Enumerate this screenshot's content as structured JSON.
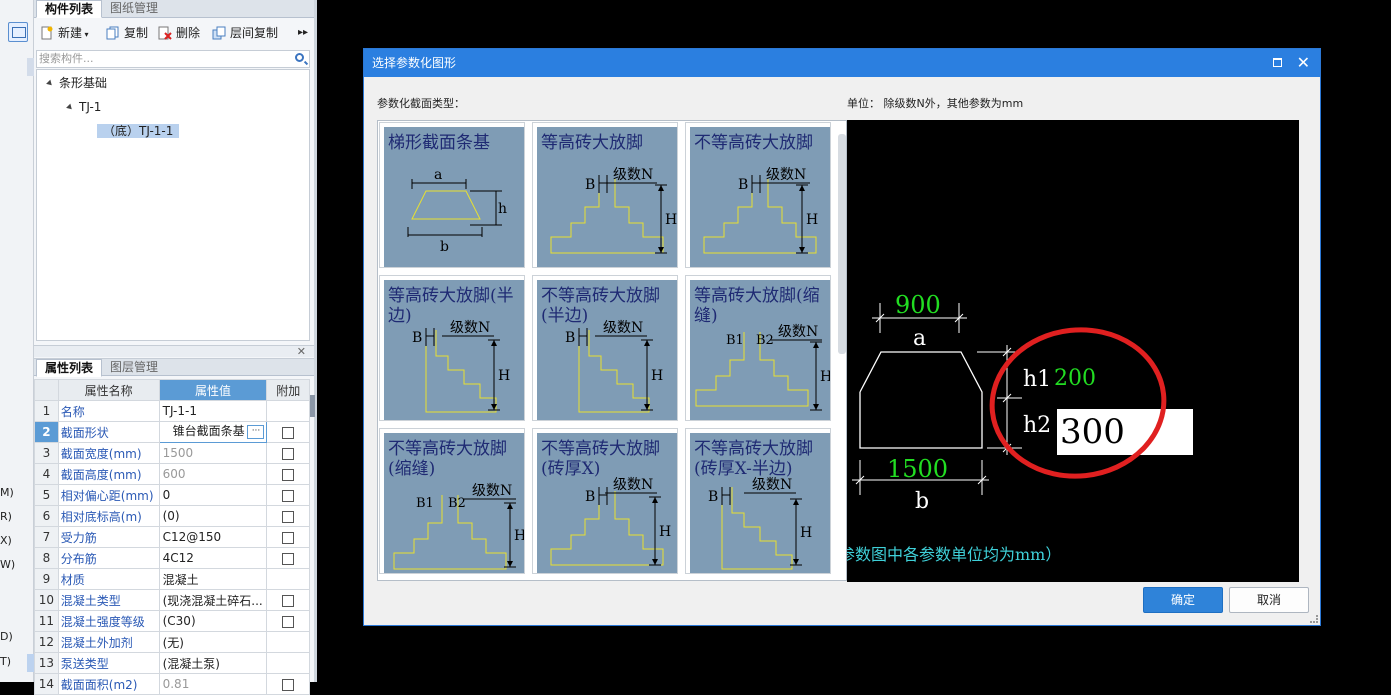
{
  "left_panel": {
    "tabs": [
      "构件列表",
      "图纸管理"
    ],
    "toolbar": [
      "新建",
      "复制",
      "删除",
      "层间复制"
    ],
    "search_placeholder": "搜索构件...",
    "tree": {
      "root": "条形基础",
      "child": "TJ-1",
      "leaf": "（底）TJ-1-1"
    },
    "strip_letters": [
      "M)",
      "R)",
      "X)",
      "W)",
      "D)",
      "T)"
    ]
  },
  "props": {
    "tabs": [
      "属性列表",
      "图层管理"
    ],
    "headers": [
      "属性名称",
      "属性值",
      "附加"
    ],
    "rows": [
      {
        "n": "1",
        "name": "名称",
        "value": "TJ-1-1"
      },
      {
        "n": "2",
        "name": "截面形状",
        "value": "锥台截面条基"
      },
      {
        "n": "3",
        "name": "截面宽度(mm)",
        "value": "1500"
      },
      {
        "n": "4",
        "name": "截面高度(mm)",
        "value": "600"
      },
      {
        "n": "5",
        "name": "相对偏心距(mm)",
        "value": "0"
      },
      {
        "n": "6",
        "name": "相对底标高(m)",
        "value": "(0)"
      },
      {
        "n": "7",
        "name": "受力筋",
        "value": "C12@150"
      },
      {
        "n": "8",
        "name": "分布筋",
        "value": "4C12"
      },
      {
        "n": "9",
        "name": "材质",
        "value": "混凝土"
      },
      {
        "n": "10",
        "name": "混凝土类型",
        "value": "(现浇混凝土碎石..."
      },
      {
        "n": "11",
        "name": "混凝土强度等级",
        "value": "(C30)"
      },
      {
        "n": "12",
        "name": "混凝土外加剂",
        "value": "(无)"
      },
      {
        "n": "13",
        "name": "泵送类型",
        "value": "(混凝土泵)"
      },
      {
        "n": "14",
        "name": "截面面积(m2)",
        "value": "0.81"
      }
    ]
  },
  "dialog": {
    "title": "选择参数化图形",
    "section_label": "参数化截面类型：",
    "unit_label": "单位：  除级数N外，其他参数为mm",
    "shapes": [
      "梯形截面条基",
      "等高砖大放脚",
      "不等高砖大放脚",
      "等高砖大放脚(半边)",
      "不等高砖大放脚(半边)",
      "等高砖大放脚(缩缝)",
      "不等高砖大放脚(缩缝)",
      "不等高砖大放脚(砖厚X)",
      "不等高砖大放脚(砖厚X-半边)"
    ],
    "thumb_labels": {
      "a": "a",
      "b": "b",
      "h": "h",
      "B": "B",
      "H": "H",
      "N": "级数N",
      "B1": "B1",
      "B2": "B2"
    },
    "preview": {
      "a_value": "900",
      "a_label": "a",
      "b_value": "1500",
      "b_label": "b",
      "h1_label": "h1",
      "h1_value": "200",
      "h2_label": "h2",
      "h2_value": "300",
      "note": "参数图中各参数单位均为mm）"
    },
    "ok": "确定",
    "cancel": "取消"
  },
  "colors": {
    "accent": "#2b7fe0",
    "cad_green": "#22dd22",
    "annotation_red": "#e02020",
    "thumb_bg": "#7f9cb5"
  }
}
